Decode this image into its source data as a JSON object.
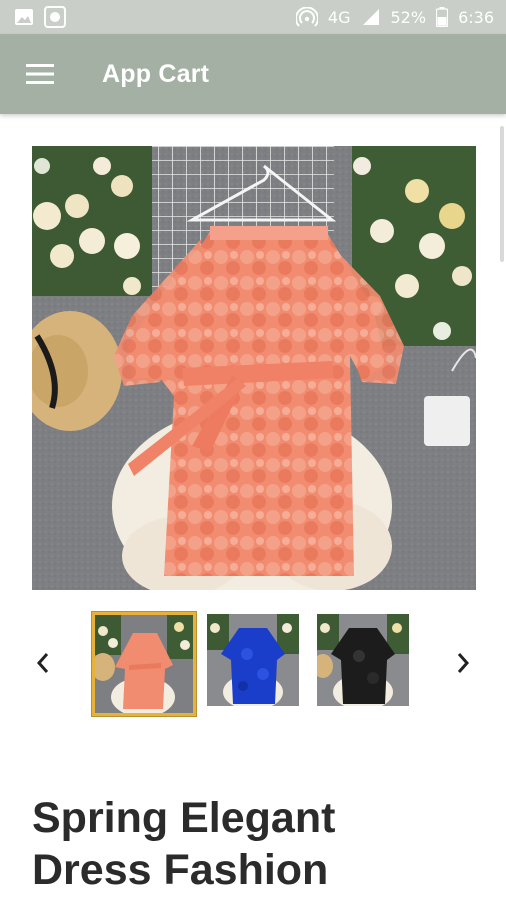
{
  "status_bar": {
    "network": "4G",
    "battery": "52%",
    "time": "6:36",
    "icons": [
      "image-icon",
      "record-icon",
      "hotspot-icon",
      "signal-icon",
      "battery-icon"
    ]
  },
  "app_bar": {
    "title": "App Cart",
    "menu_icon": "hamburger-menu-icon",
    "background": "#a5b0a4"
  },
  "product": {
    "title_line1": "Spring Elegant",
    "title_line2": "Dress Fashion",
    "main_image": "coral-petal-dress",
    "thumbnails": [
      {
        "variant": "coral",
        "color": "#f0866a",
        "selected": true
      },
      {
        "variant": "blue",
        "color": "#1a3ec9",
        "selected": false
      },
      {
        "variant": "black",
        "color": "#1c1c1c",
        "selected": false
      }
    ]
  },
  "carousel": {
    "prev_icon": "chevron-left-icon",
    "next_icon": "chevron-right-icon"
  }
}
